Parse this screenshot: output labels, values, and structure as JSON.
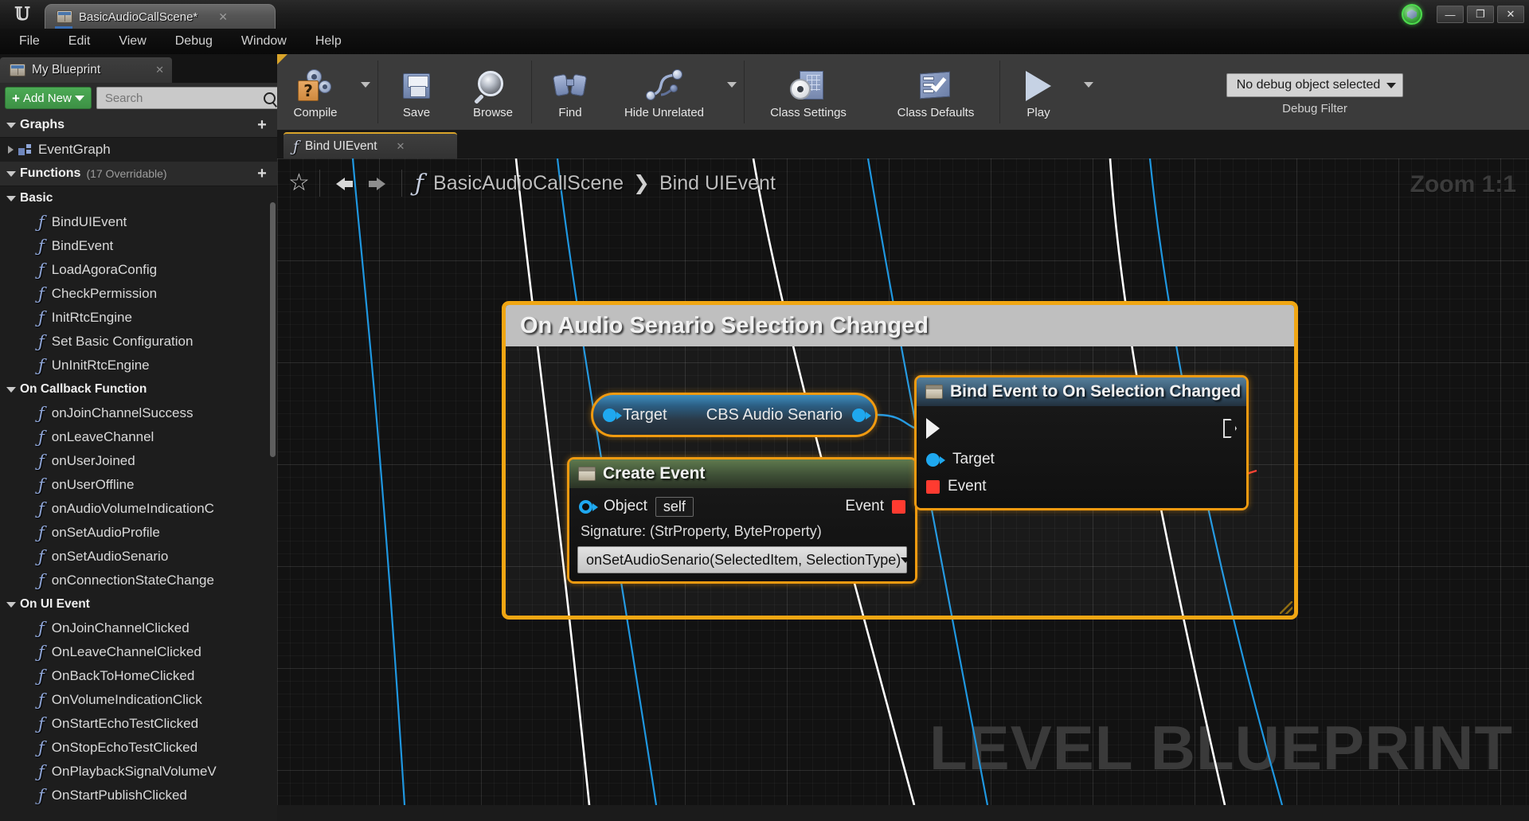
{
  "titlebar": {
    "app_icon": "unreal-logo-icon",
    "document_tab": "BasicAudioCallScene*",
    "close_glyph": "✕",
    "minimize_glyph": "—",
    "restore_glyph": "❐",
    "window_close_glyph": "✕"
  },
  "menubar": {
    "items": [
      "File",
      "Edit",
      "View",
      "Debug",
      "Window",
      "Help"
    ]
  },
  "my_blueprint": {
    "tab_label": "My Blueprint",
    "tab_close": "✕",
    "add_new_label": "Add New",
    "add_new_plus": "+",
    "search_placeholder": "Search",
    "search_value": "",
    "tree": [
      {
        "kind": "section",
        "title": "Graphs",
        "sub": "",
        "plus": "+"
      },
      {
        "kind": "graph",
        "label": "EventGraph"
      },
      {
        "kind": "section",
        "title": "Functions",
        "sub": "(17 Overridable)",
        "plus": "+"
      },
      {
        "kind": "category",
        "label": "Basic"
      },
      {
        "kind": "fn",
        "label": "BindUIEvent"
      },
      {
        "kind": "fn",
        "label": "BindEvent"
      },
      {
        "kind": "fn",
        "label": "LoadAgoraConfig"
      },
      {
        "kind": "fn",
        "label": "CheckPermission"
      },
      {
        "kind": "fn",
        "label": "InitRtcEngine"
      },
      {
        "kind": "fn",
        "label": "Set Basic Configuration"
      },
      {
        "kind": "fn",
        "label": "UnInitRtcEngine"
      },
      {
        "kind": "category",
        "label": "On Callback Function"
      },
      {
        "kind": "fn",
        "label": "onJoinChannelSuccess"
      },
      {
        "kind": "fn",
        "label": "onLeaveChannel"
      },
      {
        "kind": "fn",
        "label": "onUserJoined"
      },
      {
        "kind": "fn",
        "label": "onUserOffline"
      },
      {
        "kind": "fn",
        "label": "onAudioVolumeIndicationC"
      },
      {
        "kind": "fn",
        "label": "onSetAudioProfile"
      },
      {
        "kind": "fn",
        "label": "onSetAudioSenario"
      },
      {
        "kind": "fn",
        "label": "onConnectionStateChange"
      },
      {
        "kind": "category",
        "label": "On UI Event"
      },
      {
        "kind": "fn",
        "label": "OnJoinChannelClicked"
      },
      {
        "kind": "fn",
        "label": "OnLeaveChannelClicked"
      },
      {
        "kind": "fn",
        "label": "OnBackToHomeClicked"
      },
      {
        "kind": "fn",
        "label": "OnVolumeIndicationClick"
      },
      {
        "kind": "fn",
        "label": "OnStartEchoTestClicked"
      },
      {
        "kind": "fn",
        "label": "OnStopEchoTestClicked"
      },
      {
        "kind": "fn",
        "label": "OnPlaybackSignalVolumeV"
      },
      {
        "kind": "fn",
        "label": "OnStartPublishClicked"
      }
    ]
  },
  "toolbar": {
    "buttons": [
      {
        "label": "Compile",
        "icon": "compile-icon",
        "has_dropdown": true
      },
      {
        "label": "Save",
        "icon": "save-floppy-icon",
        "has_dropdown": false
      },
      {
        "label": "Browse",
        "icon": "browse-magnifier-icon",
        "has_dropdown": false
      },
      {
        "label": "Find",
        "icon": "find-binoculars-icon",
        "has_dropdown": false
      },
      {
        "label": "Hide Unrelated",
        "icon": "hide-unrelated-nodes-icon",
        "has_dropdown": true
      },
      {
        "label": "Class Settings",
        "icon": "class-settings-gear-icon",
        "has_dropdown": false
      },
      {
        "label": "Class Defaults",
        "icon": "class-defaults-clipboard-icon",
        "has_dropdown": false
      },
      {
        "label": "Play",
        "icon": "play-triangle-icon",
        "has_dropdown": true
      }
    ],
    "debug_object": "No debug object selected",
    "debug_filter_label": "Debug Filter"
  },
  "graph": {
    "tab_label": "Bind UIEvent",
    "tab_close": "✕",
    "breadcrumb": {
      "star": "☆",
      "back_icon": "nav-back-arrow-icon",
      "forward_icon": "nav-forward-arrow-icon",
      "fx_icon": "function-icon",
      "root": "BasicAudioCallScene",
      "separator": "❯",
      "current": "Bind UIEvent"
    },
    "zoom_level": "Zoom 1:1",
    "watermark": "LEVEL BLUEPRINT",
    "comment": {
      "title": "On Audio Senario Selection Changed",
      "border_color": "#f0a613"
    },
    "nodes": {
      "target_getter": {
        "pin_in_label": "Target",
        "value_label": "CBS Audio Senario"
      },
      "create_event": {
        "title": "Create Event",
        "icon": "event-node-icon",
        "object_pin_label": "Object",
        "object_value": "self",
        "event_pin_label": "Event",
        "signature": "Signature: (StrProperty, ByteProperty)",
        "selected_function": "onSetAudioSenario(SelectedItem, SelectionType)"
      },
      "bind_event": {
        "title": "Bind Event to On Selection Changed",
        "icon": "event-node-icon",
        "target_pin_label": "Target",
        "event_pin_label": "Event"
      }
    }
  },
  "colors": {
    "selection_orange": "#f09a10",
    "comment_yellow": "#f0a613",
    "object_pin_blue": "#1fa8ef",
    "delegate_pin_red": "#ff3b30",
    "add_new_green": "#4cab55",
    "wire_blue": "#1f97e0",
    "wire_white": "#ffffff"
  }
}
